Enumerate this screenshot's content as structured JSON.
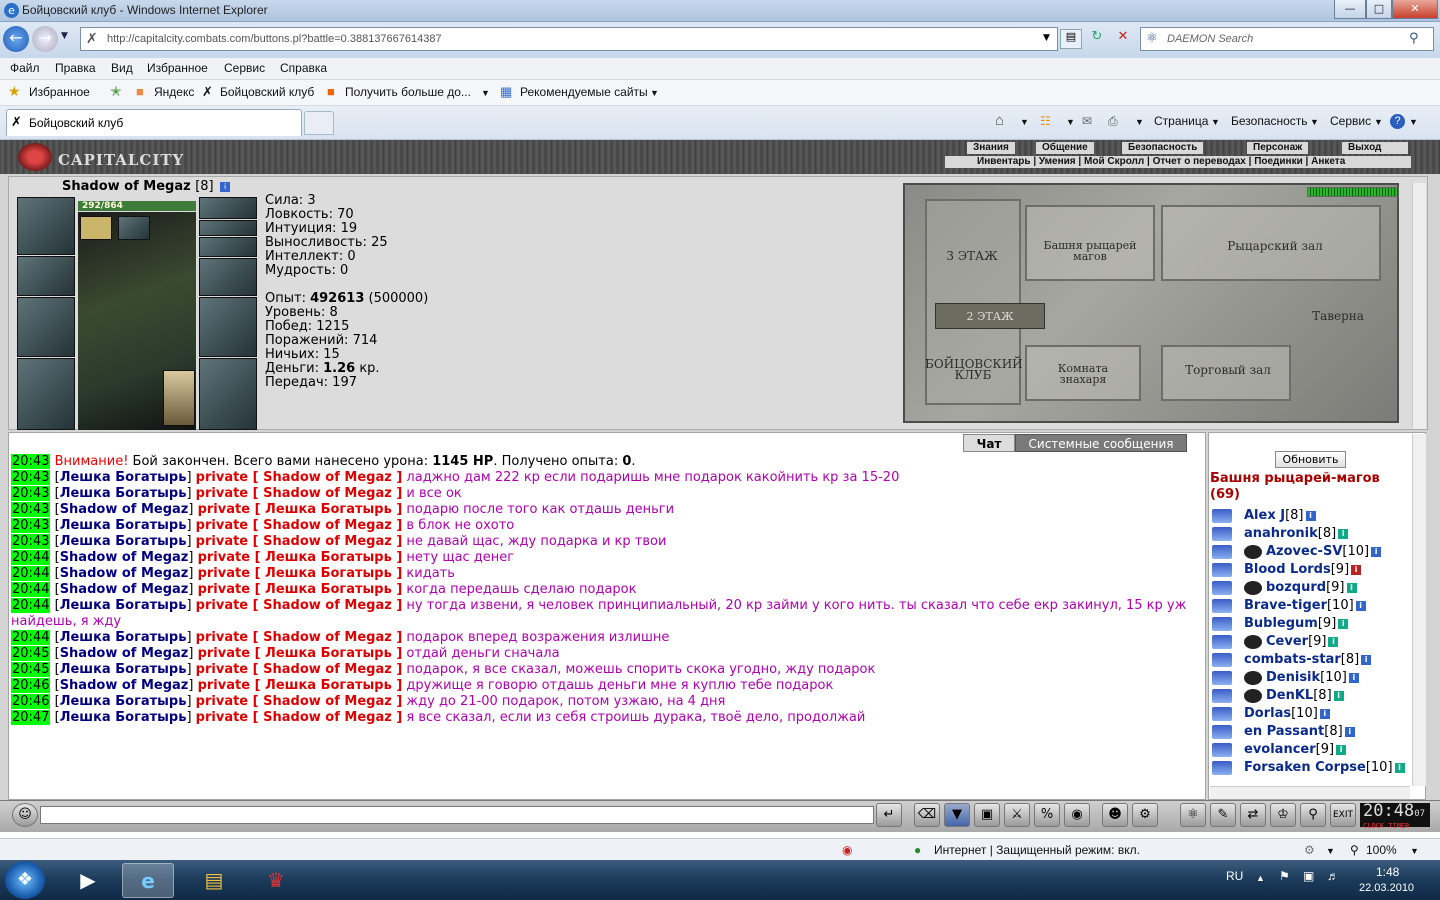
{
  "window": {
    "title": "Бойцовский клуб - Windows Internet Explorer",
    "minimize": "—",
    "maximize": "□",
    "close": "✕"
  },
  "address": {
    "url": "http://capitalcity.combats.com/buttons.pl?battle=0.388137667614387",
    "search_placeholder": "DAEMON Search"
  },
  "menu": [
    "Файл",
    "Правка",
    "Вид",
    "Избранное",
    "Сервис",
    "Справка"
  ],
  "favorites": {
    "label": "Избранное",
    "items": [
      "Яндекс",
      "Бойцовский клуб",
      "Получить больше до...",
      "Рекомендуемые сайты"
    ]
  },
  "tab": {
    "title": "Бойцовский клуб"
  },
  "commandbar": [
    "Страница",
    "Безопасность",
    "Сервис"
  ],
  "game": {
    "logo": "CAPITALCITY",
    "menu_top": [
      "Знания",
      "Общение",
      "Безопасность",
      "Персонаж",
      "Выход"
    ],
    "menu_bottom": [
      "Инвентарь",
      "Умения",
      "Мой Скролл",
      "Отчет о переводах",
      "Поединки",
      "Анкета"
    ],
    "char": {
      "name": "Shadow of Megaz",
      "level": "[8]",
      "hp": "292/864"
    },
    "stats": [
      {
        "label": "Сила: ",
        "value": "3"
      },
      {
        "label": "Ловкость: ",
        "value": "70"
      },
      {
        "label": "Интуиция: ",
        "value": "19"
      },
      {
        "label": "Выносливость: ",
        "value": "25"
      },
      {
        "label": "Интеллект: ",
        "value": "0"
      },
      {
        "label": "Мудрость: ",
        "value": "0"
      }
    ],
    "exp": {
      "label": "Опыт: ",
      "value": "492613",
      "next": " (500000)"
    },
    "stats2": [
      {
        "label": "Уровень: ",
        "value": "8"
      },
      {
        "label": "Побед: ",
        "value": "1215"
      },
      {
        "label": "Поражений: ",
        "value": "714"
      },
      {
        "label": "Ничьих: ",
        "value": "15"
      }
    ],
    "money": {
      "label": "Деньги: ",
      "value": "1.26",
      "unit": " кр."
    },
    "transfers": {
      "label": "Передач: ",
      "value": "197"
    },
    "map": {
      "floor3": "3 ЭТАЖ",
      "floor2": "2 ЭТАЖ",
      "club": "БОЙЦОВСКИЙ\nКЛУБ",
      "tower": "Башня рыцарей\nмагов",
      "knights": "Рыцарский зал",
      "tavern": "Таверна",
      "healer": "Комната\nзнахаря",
      "trade": "Торговый зал"
    },
    "chat_tabs": [
      "Чат",
      "Системные сообщения"
    ],
    "refresh": "Обновить",
    "room": "Башня рыцарей-магов (69)"
  },
  "chat": [
    {
      "ts": "20:43",
      "sys": true,
      "warn": "Внимание!",
      "text": " Бой закончен. Всего вами нанесено урона: ",
      "b1": "1145 HP",
      "t2": ". Получено опыта: ",
      "b2": "0",
      "t3": "."
    },
    {
      "ts": "20:43",
      "from": "Лешка Богатырь",
      "to": "Shadow of Megaz",
      "msg": "ладжно дам 222 кр если подаришь мне подарок какойнить кр за 15-20"
    },
    {
      "ts": "20:43",
      "from": "Лешка Богатырь",
      "to": "Shadow of Megaz",
      "msg": "и все ок"
    },
    {
      "ts": "20:43",
      "from": "Shadow of Megaz",
      "to": "Лешка Богатырь",
      "msg": "подарю после того как отдашь деньги"
    },
    {
      "ts": "20:43",
      "from": "Лешка Богатырь",
      "to": "Shadow of Megaz",
      "msg": "в блок не охото"
    },
    {
      "ts": "20:43",
      "from": "Лешка Богатырь",
      "to": "Shadow of Megaz",
      "msg": "не давай щас, жду подарка и кр твои"
    },
    {
      "ts": "20:44",
      "from": "Shadow of Megaz",
      "to": "Лешка Богатырь",
      "msg": "нету щас денег"
    },
    {
      "ts": "20:44",
      "from": "Shadow of Megaz",
      "to": "Лешка Богатырь",
      "msg": "кидать"
    },
    {
      "ts": "20:44",
      "from": "Shadow of Megaz",
      "to": "Лешка Богатырь",
      "msg": "когда передашь сделаю подарок"
    },
    {
      "ts": "20:44",
      "from": "Лешка Богатырь",
      "to": "Shadow of Megaz",
      "msg": "ну тогда извени, я человек принципиальный, 20 кр займи у кого нить. ты сказал что себе екр закинул, 15 кр уж",
      "cont": "найдешь, я жду"
    },
    {
      "ts": "20:44",
      "from": "Лешка Богатырь",
      "to": "Shadow of Megaz",
      "msg": "подарок вперед возражения излишне"
    },
    {
      "ts": "20:45",
      "from": "Shadow of Megaz",
      "to": "Лешка Богатырь",
      "msg": "отдай деньги сначала"
    },
    {
      "ts": "20:45",
      "from": "Лешка Богатырь",
      "to": "Shadow of Megaz",
      "msg": "подарок, я все сказал, можешь спорить скока угодно, жду подарок"
    },
    {
      "ts": "20:46",
      "from": "Shadow of Megaz",
      "to": "Лешка Богатырь",
      "msg": "дружище я говорю отдашь деньги мне я куплю тебе подарок"
    },
    {
      "ts": "20:46",
      "from": "Лешка Богатырь",
      "to": "Shadow of Megaz",
      "msg": "жду до 21-00 подарок, потом узжаю, на 4 дня"
    },
    {
      "ts": "20:47",
      "from": "Лешка Богатырь",
      "to": "Shadow of Megaz",
      "msg": "я все сказал, если из себя строишь дурака, твоё дело, продолжай"
    }
  ],
  "private_label": "private",
  "users": [
    {
      "name": "Alex J",
      "level": "[8]"
    },
    {
      "name": "anahronik",
      "level": "[8]"
    },
    {
      "name": "Azovec-SV",
      "level": "[10]"
    },
    {
      "name": "Blood Lords",
      "level": "[9]"
    },
    {
      "name": "bozqurd",
      "level": "[9]"
    },
    {
      "name": "Brave-tiger",
      "level": "[10]"
    },
    {
      "name": "Bublegum",
      "level": "[9]"
    },
    {
      "name": "Cever",
      "level": "[9]"
    },
    {
      "name": "combats-star",
      "level": "[8]"
    },
    {
      "name": "Denisik",
      "level": "[10]"
    },
    {
      "name": "DenKL",
      "level": "[8]"
    },
    {
      "name": "Dorlas",
      "level": "[10]"
    },
    {
      "name": "en Passant",
      "level": "[8]"
    },
    {
      "name": "evolancer",
      "level": "[9]"
    },
    {
      "name": "Forsaken Corpse",
      "level": "[10]"
    }
  ],
  "clock": {
    "time": "20:48",
    "sec": "07",
    "labels": "CLOCK TIMER"
  },
  "statusbar": {
    "zone": "Интернет | Защищенный режим: вкл.",
    "zoom": "100%"
  },
  "tray": {
    "lang": "RU",
    "time": "1:48",
    "date": "22.03.2010"
  }
}
